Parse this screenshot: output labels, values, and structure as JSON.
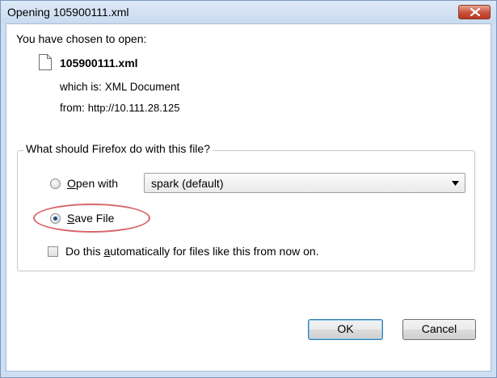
{
  "window": {
    "title": "Opening 105900111.xml",
    "close_icon": "close-x-icon"
  },
  "intro_text": "You have chosen to open:",
  "file": {
    "icon": "document-icon",
    "name": "105900111.xml",
    "which_label": "which is:",
    "which_value": "XML Document",
    "from_label": "from:",
    "from_value": "http://10.111.28.125"
  },
  "group": {
    "label": "What should Firefox do with this file?",
    "open_with": {
      "prefix": "",
      "accel": "O",
      "rest": "pen with",
      "selected": false
    },
    "open_with_select": {
      "value": "spark (default)",
      "arrow_icon": "dropdown-arrow-icon"
    },
    "save_file": {
      "accel": "S",
      "rest": "ave File",
      "selected": true
    },
    "auto_checkbox": {
      "prefix": "Do this ",
      "accel": "a",
      "rest": "utomatically for files like this from now on.",
      "checked": false
    }
  },
  "buttons": {
    "ok": "OK",
    "cancel": "Cancel"
  },
  "colors": {
    "highlight_ellipse": "#d9656a",
    "close_button": "#c7513b",
    "radio_dot": "#1a4a8a"
  }
}
